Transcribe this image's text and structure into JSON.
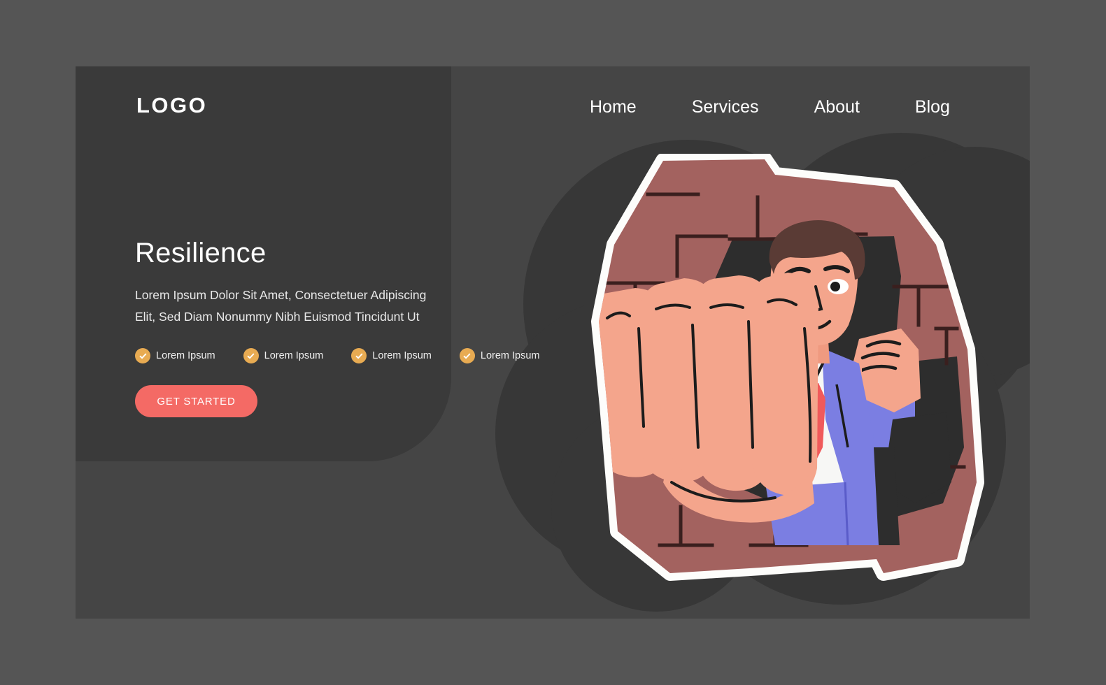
{
  "page": {
    "background_color": "#555555",
    "card_color": "#454545",
    "panel_color": "#3a3a3a",
    "blob_color": "#373737"
  },
  "header": {
    "logo": "LOGO",
    "nav": [
      {
        "label": "Home"
      },
      {
        "label": "Services"
      },
      {
        "label": "About"
      },
      {
        "label": "Blog"
      }
    ]
  },
  "hero": {
    "title": "Resilience",
    "subtitle": "Lorem Ipsum Dolor Sit Amet, Consectetuer Adipiscing Elit, Sed Diam Nonummy Nibh Euismod Tincidunt Ut",
    "features": [
      {
        "label": "Lorem Ipsum",
        "icon": "check-circle-icon"
      },
      {
        "label": "Lorem Ipsum",
        "icon": "check-circle-icon"
      },
      {
        "label": "Lorem Ipsum",
        "icon": "check-circle-icon"
      },
      {
        "label": "Lorem Ipsum",
        "icon": "check-circle-icon"
      }
    ],
    "cta_label": "GET STARTED",
    "cta_color": "#f46a65",
    "check_color": "#e8ab52"
  },
  "illustration": {
    "name": "businessman-punching-through-brick-wall",
    "colors": {
      "wall_brick": "#a3625f",
      "wall_hole": "#2d2d2d",
      "outline_white": "#fdfdfb",
      "skin": "#f4a58c",
      "suit": "#7b7ee2",
      "shirt": "#f7f7f5",
      "tie": "#f05a5b",
      "hair": "#5a3b35",
      "line": "#1c1c1c"
    }
  }
}
